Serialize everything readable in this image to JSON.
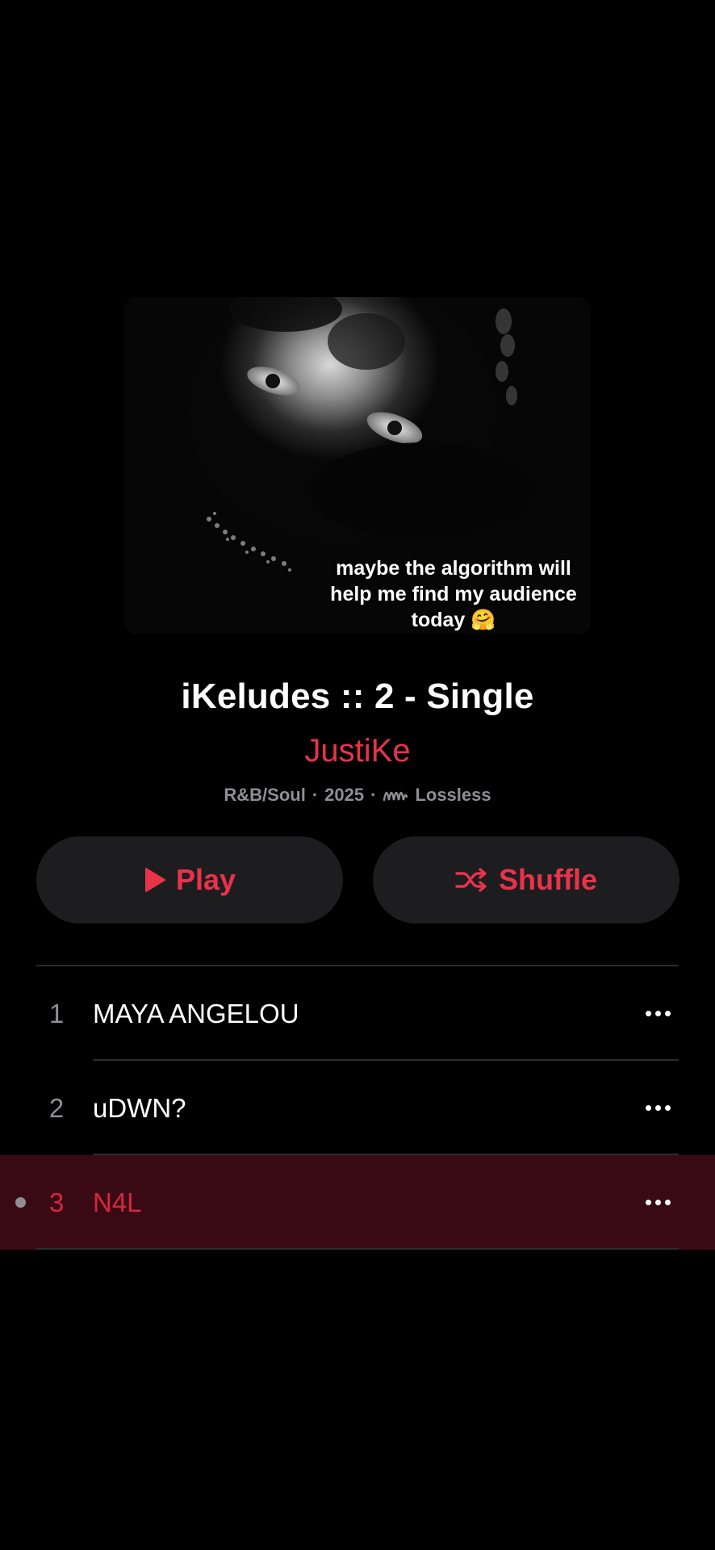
{
  "artwork": {
    "caption": "maybe the algorithm will help me find my audience today 🤗"
  },
  "album": {
    "title": "iKeludes :: 2 - Single",
    "artist": "JustiKe",
    "genre": "R&B/Soul",
    "year": "2025",
    "separator": "·",
    "quality": "Lossless"
  },
  "buttons": {
    "play": "Play",
    "shuffle": "Shuffle"
  },
  "colors": {
    "accent": "#e8334a",
    "active_row_bg": "#3a0a14",
    "button_bg": "#1d1d1f",
    "secondary_text": "#8e8e93"
  },
  "tracks": [
    {
      "number": "1",
      "title": "MAYA ANGELOU",
      "playing": false
    },
    {
      "number": "2",
      "title": "uDWN?",
      "playing": false
    },
    {
      "number": "3",
      "title": "N4L",
      "playing": true
    }
  ]
}
